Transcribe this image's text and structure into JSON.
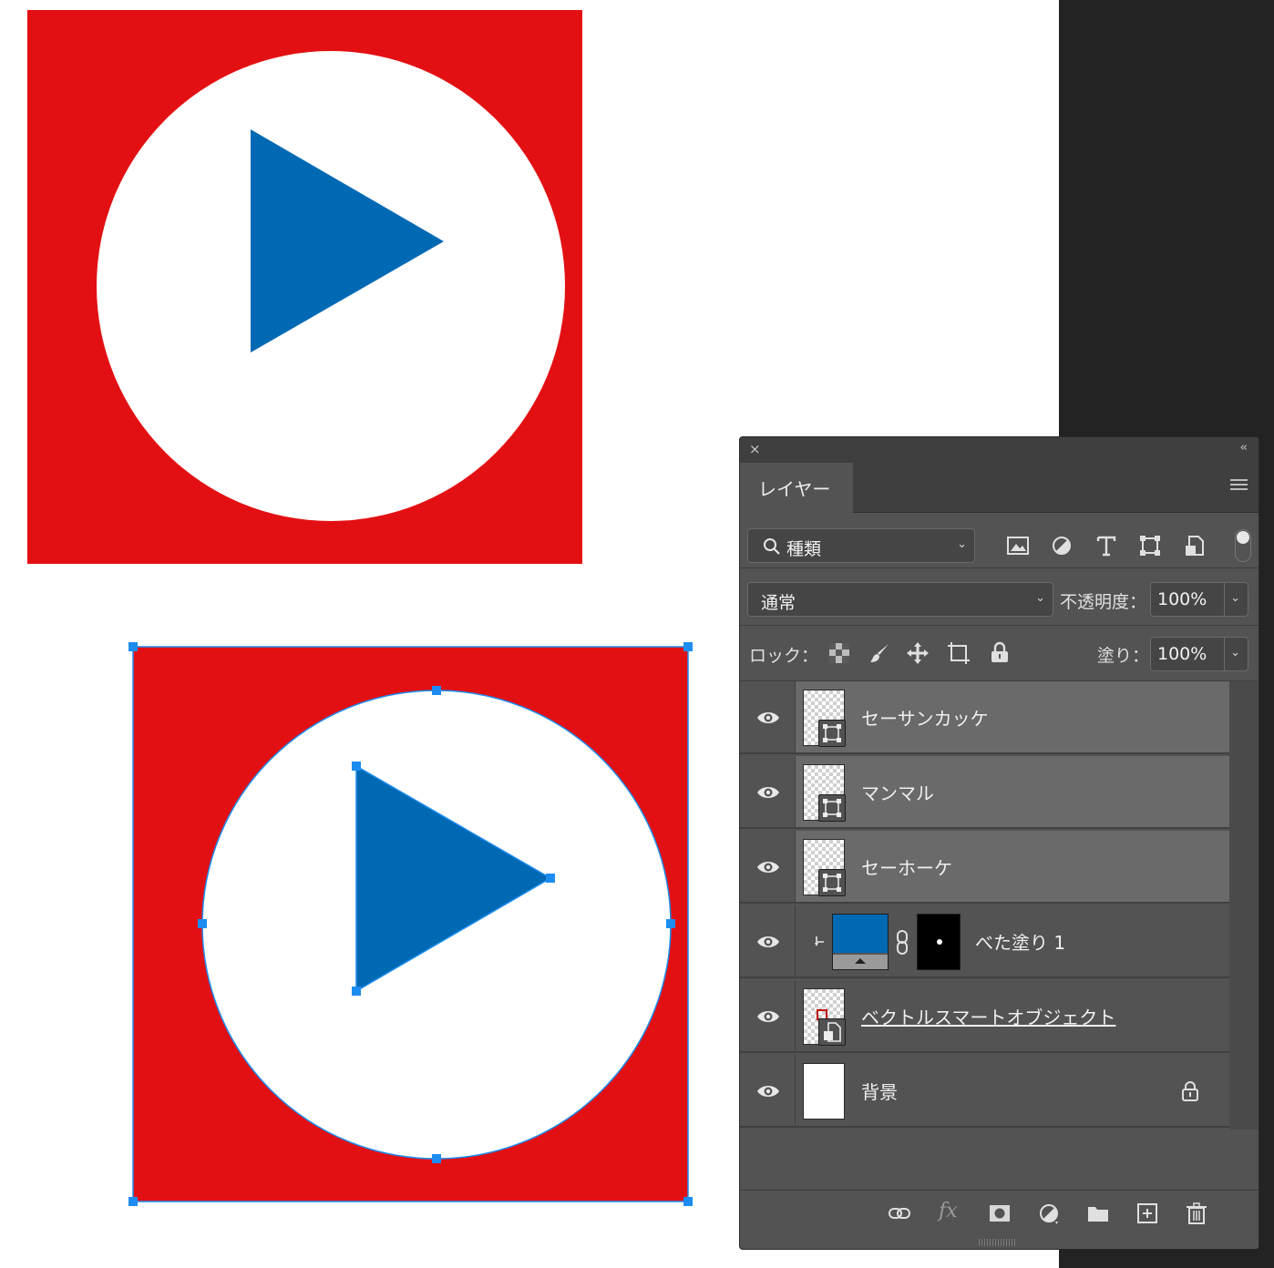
{
  "colors": {
    "red": "#e31013",
    "blue": "#0069b4",
    "selection": "#1c8cf0"
  },
  "panel": {
    "title_icons": {
      "close": "×",
      "collapse": "‹‹"
    },
    "tab_label": "レイヤー",
    "filter": {
      "value": "種類",
      "icons": [
        "image-filter-icon",
        "adjustment-filter-icon",
        "type-filter-icon",
        "shape-filter-icon",
        "smartobject-filter-icon"
      ]
    },
    "blend_mode": "通常",
    "opacity_label": "不透明度：",
    "opacity_value": "100%",
    "lock_label": "ロック：",
    "fill_label": "塗り：",
    "fill_value": "100%",
    "layers": [
      {
        "name": "セーサンカッケ",
        "kind": "shape",
        "selected": true
      },
      {
        "name": "マンマル",
        "kind": "shape",
        "selected": true
      },
      {
        "name": "セーホーケ",
        "kind": "shape",
        "selected": true
      },
      {
        "name": "べた塗り 1",
        "kind": "fill",
        "selected": false
      },
      {
        "name": "ベクトルスマートオブジェクト",
        "kind": "smart-object",
        "selected": false
      },
      {
        "name": "背景",
        "kind": "background",
        "selected": false
      }
    ],
    "footer_icons": [
      "link-icon",
      "fx-icon",
      "mask-icon",
      "adjustment-icon",
      "folder-icon",
      "new-layer-icon",
      "trash-icon"
    ],
    "fx_text": "fx"
  }
}
